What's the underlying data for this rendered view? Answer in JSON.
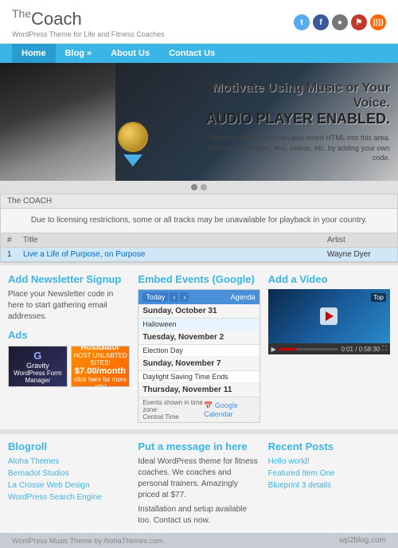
{
  "site": {
    "title_the": "The",
    "title_coach": "Coach",
    "tagline": "WordPress Theme for Life and Fitness Coaches"
  },
  "social": {
    "icons": [
      "Twitter",
      "Facebook",
      "Circle1",
      "Flag",
      "RSS"
    ]
  },
  "nav": {
    "items": [
      "Home",
      "Blog »",
      "About Us",
      "Contact Us"
    ],
    "active": "Home"
  },
  "hero": {
    "headline": "Motivate Using Music or Your Voice.",
    "subheadline": "AUDIO PLAYER ENABLED.",
    "description": "Optional Player. You can also insert HTML into this area. That means images, text, videos, etc. by adding your own code."
  },
  "player": {
    "name": "The COACH",
    "notice": "Due to licensing restrictions, some or all tracks may be unavailable for playback in your country.",
    "columns": {
      "num": "#",
      "title": "Title",
      "artist": "Artist"
    },
    "tracks": [
      {
        "num": "1",
        "title": "Live a Life of Purpose, on Purpose",
        "artist": "Wayne Dyer"
      }
    ]
  },
  "newsletter": {
    "title": "Add Newsletter Signup",
    "body": "Place your Newsletter code in here to start gathering email addresses."
  },
  "ads": {
    "title": "Ads",
    "ad1": {
      "name": "Gravity",
      "sub": "WordPress Form Manager"
    },
    "ad2": {
      "name": "HostGator",
      "sub": "HOST UNLIMITED SITES!",
      "price": "$7.00/month",
      "cta": "click here for more info!"
    }
  },
  "calendar": {
    "title": "Embed Events (Google)",
    "header_month": "Today",
    "nav_prev": "‹",
    "nav_next": "›",
    "current_view": "Agenda",
    "events": [
      {
        "date": "Sunday, October 31",
        "event": "Halloween",
        "special": true
      },
      {
        "date": "Tuesday, November 2",
        "event": "Election Day",
        "special": false
      },
      {
        "date": "Sunday, November 7",
        "event": "Daylight Saving Time Ends",
        "special": false
      },
      {
        "date": "Thursday, November 11",
        "event": "",
        "special": false
      }
    ],
    "footer_timezone": "Events shown in time zone:",
    "footer_tz_value": "Central Time",
    "footer_powered": "Google Calendar"
  },
  "video": {
    "title": "Add a Video",
    "time_current": "0:01",
    "time_total": "0:58:30"
  },
  "blogroll": {
    "title": "Blogroll",
    "links": [
      "Aloha Themes",
      "Bernadot Studios",
      "La Crosse Web Design",
      "WordPress Search Engine"
    ]
  },
  "message": {
    "title": "Put a message in here",
    "body": "Ideal WordPress theme for fitness coaches. We coaches and personal trainers. Amazingly priced at $77.",
    "body2": "Installation and setup available too. Contact us now."
  },
  "recent_posts": {
    "title": "Recent Posts",
    "posts": [
      "Hello world!",
      "Featured Item One",
      "Blueprint 3 details"
    ]
  },
  "footer": {
    "theme_text": "WordPress Music Theme by AlohaThemes.com.",
    "watermark": "wp2blog.com"
  }
}
